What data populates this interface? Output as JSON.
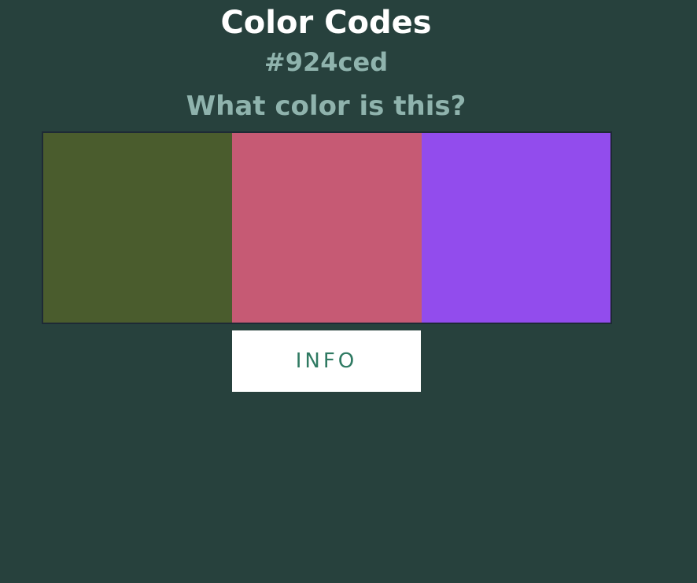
{
  "header": {
    "title": "Color Codes",
    "hex_code": "#924ced",
    "question": "What color is this?"
  },
  "swatches": [
    {
      "color": "#4a5c2d"
    },
    {
      "color": "#c65a74"
    },
    {
      "color": "#924ced"
    }
  ],
  "info_button": {
    "label": "INFO"
  },
  "colors": {
    "background": "#27413d",
    "title": "#ffffff",
    "subtitle": "#8fb3ad",
    "button_bg": "#ffffff",
    "button_text": "#2f7a62"
  }
}
